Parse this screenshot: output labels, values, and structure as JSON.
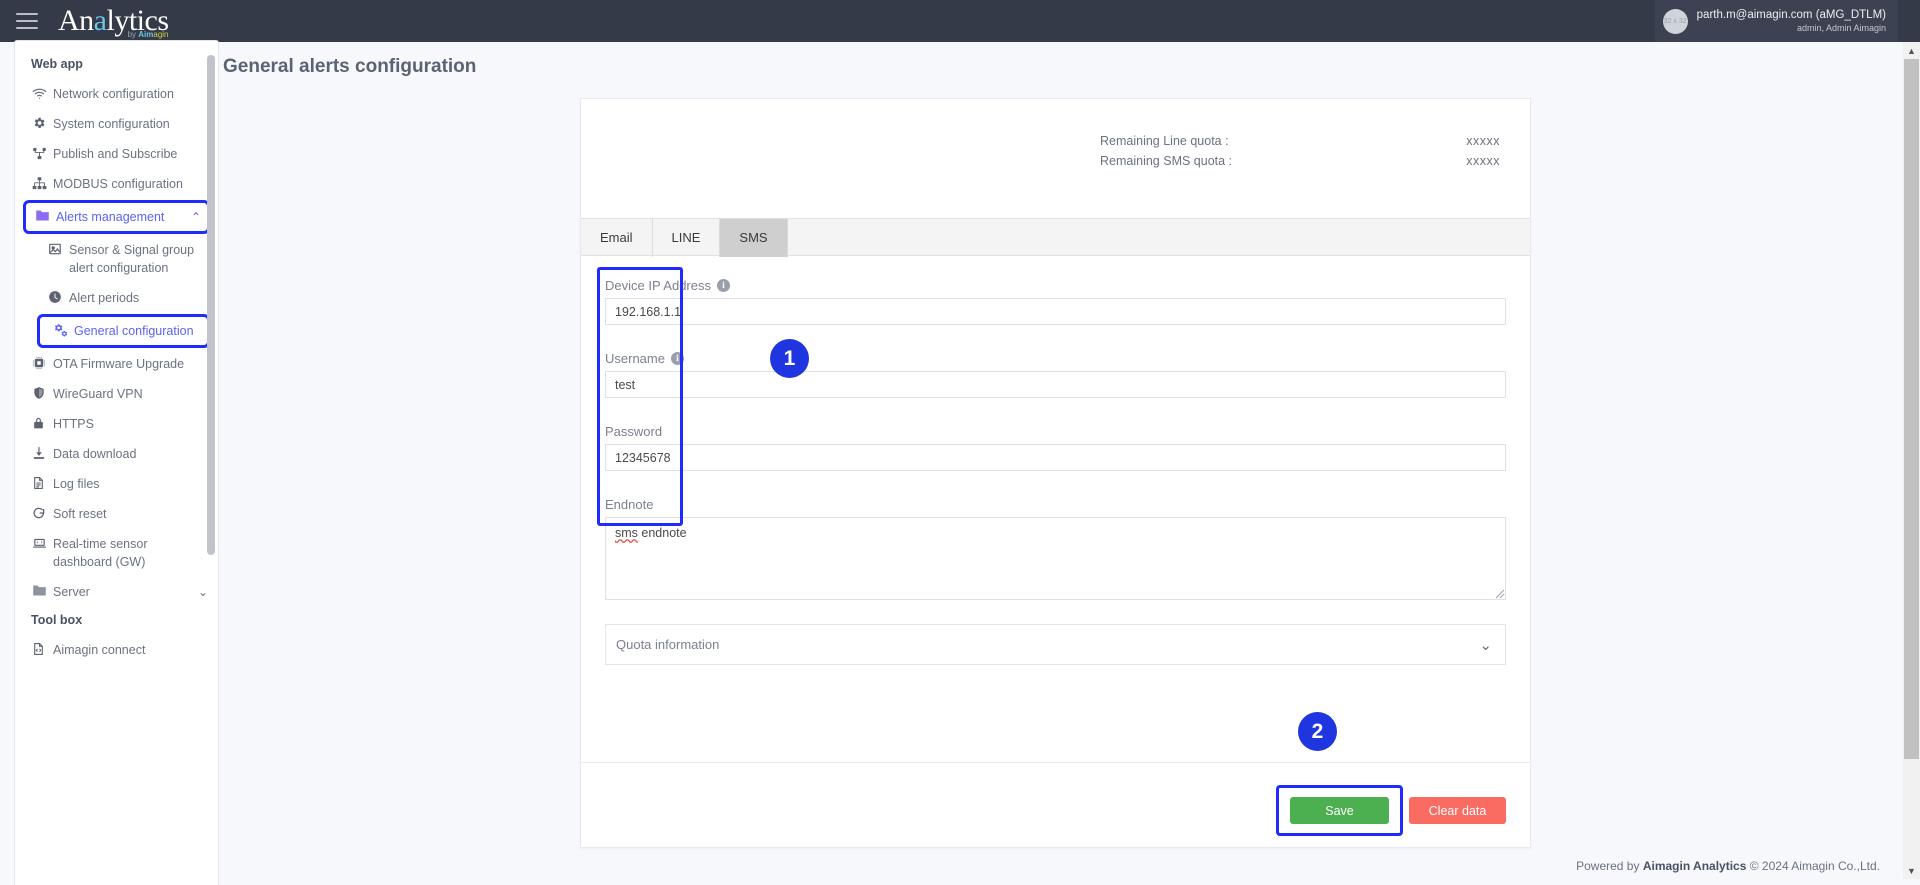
{
  "topbar": {
    "menu_icon": "hamburger-icon",
    "brand_pre": "An",
    "brand_accent": "a",
    "brand_post": "lytics",
    "brand_sub_by": "by ",
    "brand_sub_ai": "Aim",
    "brand_sub_agin": "agin",
    "avatar_text": "32 x 32",
    "user_email": "parth.m@aimagin.com (aMG_DTLM)",
    "user_role": "admin, Admin Aimagin"
  },
  "sidebar": {
    "sections": [
      {
        "label": "Web app",
        "items": [
          {
            "label": "Network configuration",
            "icon": "wifi-icon",
            "highlighted": false
          },
          {
            "label": "System configuration",
            "icon": "gear-icon",
            "highlighted": false
          },
          {
            "label": "Publish and Subscribe",
            "icon": "share-icon",
            "highlighted": false
          },
          {
            "label": "MODBUS configuration",
            "icon": "sitemap-icon",
            "highlighted": false
          },
          {
            "label": "Alerts management",
            "icon": "folder-icon",
            "chevron": "⌃",
            "highlighted": true
          },
          {
            "label": "Sensor & Signal group alert configuration",
            "icon": "image-icon",
            "sub": true
          },
          {
            "label": "Alert periods",
            "icon": "clock-icon",
            "sub": true
          },
          {
            "label": "General configuration",
            "icon": "gears-icon",
            "sub": true,
            "highlighted": true
          },
          {
            "label": "OTA Firmware Upgrade",
            "icon": "chip-icon"
          },
          {
            "label": "WireGuard VPN",
            "icon": "shield-icon"
          },
          {
            "label": "HTTPS",
            "icon": "lock-icon"
          },
          {
            "label": "Data download",
            "icon": "download-icon"
          },
          {
            "label": "Log files",
            "icon": "file-icon"
          },
          {
            "label": "Soft reset",
            "icon": "refresh-icon"
          },
          {
            "label": "Real-time sensor dashboard (GW)",
            "icon": "laptop-icon"
          },
          {
            "label": "Server",
            "icon": "folder-icon",
            "chevron": "⌄"
          }
        ]
      },
      {
        "label": "Tool box",
        "items": [
          {
            "label": "Aimagin connect",
            "icon": "file-code-icon"
          }
        ]
      }
    ]
  },
  "main": {
    "page_title": "General alerts configuration",
    "quota": [
      {
        "label": "Remaining Line quota :",
        "value": "xxxxx"
      },
      {
        "label": "Remaining SMS quota :",
        "value": "xxxxx"
      }
    ],
    "tabs": [
      {
        "label": "Email",
        "active": false
      },
      {
        "label": "LINE",
        "active": false
      },
      {
        "label": "SMS",
        "active": true
      }
    ],
    "fields": {
      "device_ip": {
        "label": "Device IP Address",
        "info": "i",
        "value": "192.168.1.1",
        "placeholder": ""
      },
      "username": {
        "label": "Username",
        "info": "i",
        "value": "test",
        "placeholder": ""
      },
      "password": {
        "label": "Password",
        "value": "12345678",
        "placeholder": ""
      },
      "endnote": {
        "label": "Endnote",
        "value_misspelled": "sms",
        "value_rest": " endnote",
        "placeholder": ""
      }
    },
    "accordion": {
      "label": "Quota information",
      "chevron": "⌄"
    },
    "buttons": {
      "save": "Save",
      "clear": "Clear data"
    },
    "step_badges": [
      {
        "number": "1"
      },
      {
        "number": "2"
      }
    ]
  },
  "footer": {
    "prefix": "Powered by ",
    "brand": "Aimagin Analytics",
    "suffix": " © 2024 Aimagin Co.,Ltd."
  },
  "colors": {
    "topbar_bg": "#343a47",
    "highlight_blue": "#1f2bff",
    "badge_blue": "#1f35e0",
    "save_green": "#4caf50",
    "clear_red": "#fa6b62",
    "folder_purple": "#8c6cf0"
  }
}
